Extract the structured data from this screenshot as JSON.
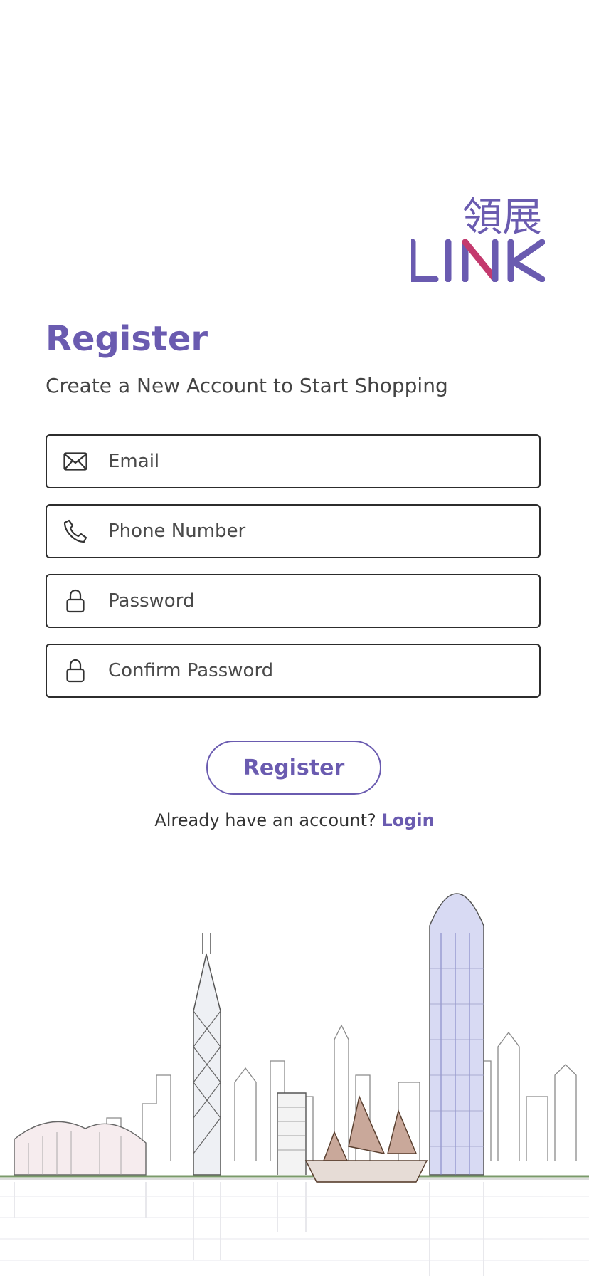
{
  "logo": {
    "chinese": "領展",
    "text": "LINK",
    "colors": {
      "primary": "#6a5bb0",
      "accent": "#c43a6e"
    }
  },
  "page": {
    "title": "Register",
    "subtitle": "Create a New Account to Start Shopping"
  },
  "form": {
    "email": {
      "placeholder": "Email",
      "value": "",
      "icon": "envelope-icon"
    },
    "phone": {
      "placeholder": "Phone Number",
      "value": "",
      "icon": "phone-icon"
    },
    "password": {
      "placeholder": "Password",
      "value": "",
      "icon": "lock-icon"
    },
    "confirm_password": {
      "placeholder": "Confirm Password",
      "value": "",
      "icon": "lock-icon"
    },
    "submit_label": "Register"
  },
  "footer": {
    "prompt": "Already have an account?",
    "login_label": "Login"
  },
  "colors": {
    "accent": "#6a5bb0",
    "text": "#3a3a3a",
    "border": "#2c2c2c"
  }
}
